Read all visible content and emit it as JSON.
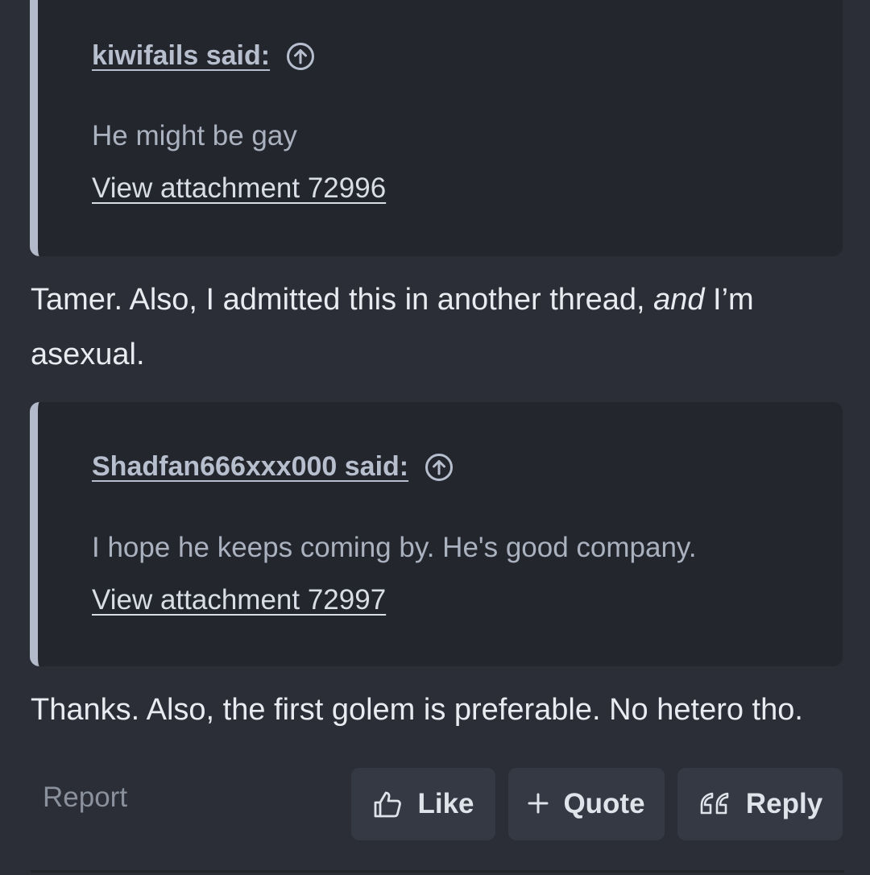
{
  "posts": [
    {
      "quote": {
        "author_said": "kiwifails said:",
        "text": "He might be gay",
        "attachment": "View attachment 72996"
      },
      "reply_parts": [
        "Tamer. Also, I admitted this in another thread, ",
        "and",
        " I’m asexual."
      ]
    },
    {
      "quote": {
        "author_said": "Shadfan666xxx000 said:",
        "text": "I hope he keeps coming by. He's good company.",
        "attachment": "View attachment 72997"
      },
      "reply_text": "Thanks. Also, the first golem is preferable. No hetero tho."
    }
  ],
  "actions": {
    "report_label": "Report",
    "like_label": "Like",
    "quote_label": "Quote",
    "reply_label": "Reply"
  },
  "icons": {
    "jump_to_post": "arrow-up-circle-icon",
    "like": "thumbs-up-icon",
    "quote": "plus-icon",
    "reply": "quote-marks-icon"
  },
  "colors": {
    "background": "#2b2e37",
    "quote_background": "#24262d",
    "quote_border": "#b3bac9",
    "button_background": "#353944"
  }
}
